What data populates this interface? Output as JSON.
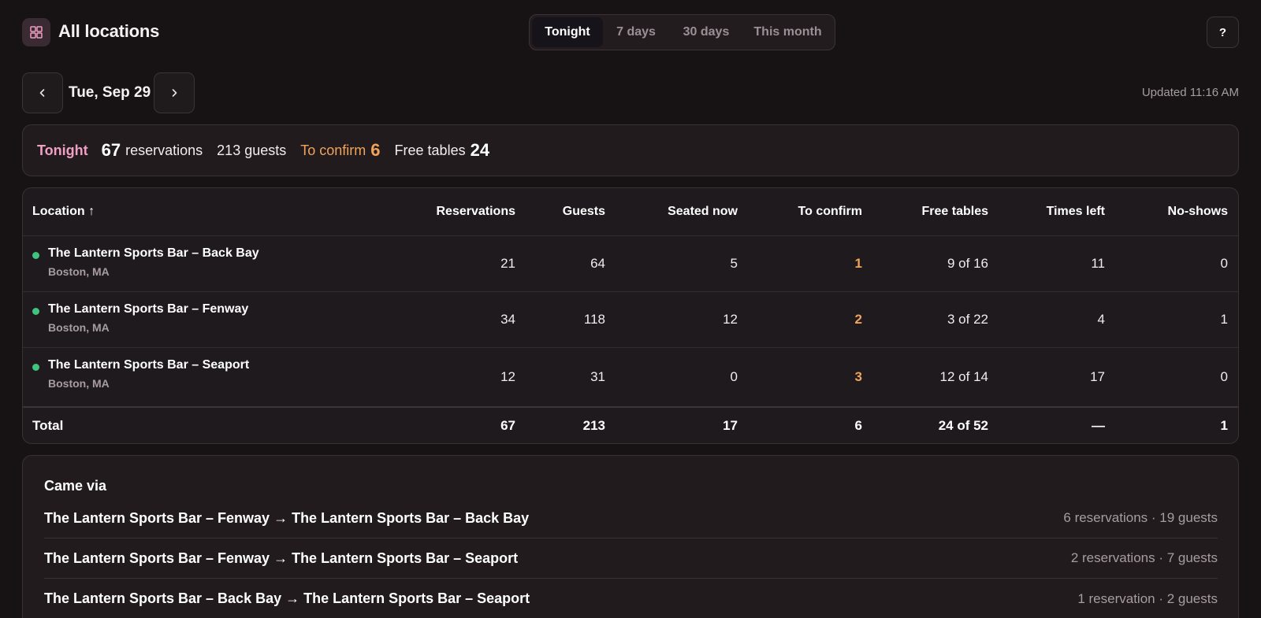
{
  "header": {
    "title": "All locations",
    "icon": "grid-icon",
    "tabs": [
      {
        "label": "Tonight",
        "active": true
      },
      {
        "label": "7 days",
        "active": false
      },
      {
        "label": "30 days",
        "active": false
      },
      {
        "label": "This month",
        "active": false
      }
    ],
    "help_label": "?"
  },
  "date_nav": {
    "date": "Tue, Sep 29",
    "prev_icon": "chevron-left-icon",
    "next_icon": "chevron-right-icon",
    "updated": "Updated 11:16 AM"
  },
  "summary": {
    "label": "Tonight",
    "reservations_value": "67",
    "reservations_label": "reservations",
    "guests": "213 guests",
    "to_confirm_label": "To confirm",
    "to_confirm_value": "6",
    "free_tables_label": "Free tables",
    "free_tables_value": "24"
  },
  "table": {
    "columns": [
      "Location ↑",
      "Reservations",
      "Guests",
      "Seated now",
      "To confirm",
      "Free tables",
      "Times left",
      "No-shows"
    ],
    "rows": [
      {
        "name": "The Lantern Sports Bar – Back Bay",
        "city": "Boston, MA",
        "status": "open",
        "reservations": "21",
        "guests": "64",
        "seated_now": "5",
        "to_confirm": "1",
        "free_tables": "9 of 16",
        "times_left": "11",
        "no_shows": "0"
      },
      {
        "name": "The Lantern Sports Bar – Fenway",
        "city": "Boston, MA",
        "status": "open",
        "reservations": "34",
        "guests": "118",
        "seated_now": "12",
        "to_confirm": "2",
        "free_tables": "3 of 22",
        "times_left": "4",
        "no_shows": "1"
      },
      {
        "name": "The Lantern Sports Bar – Seaport",
        "city": "Boston, MA",
        "status": "open",
        "reservations": "12",
        "guests": "31",
        "seated_now": "0",
        "to_confirm": "3",
        "free_tables": "12 of 14",
        "times_left": "17",
        "no_shows": "0"
      }
    ],
    "total": {
      "label": "Total",
      "reservations": "67",
      "guests": "213",
      "seated_now": "17",
      "to_confirm": "6",
      "free_tables": "24 of 52",
      "times_left": "—",
      "no_shows": "1"
    }
  },
  "came_via": {
    "title": "Came via",
    "items": [
      {
        "route": "The Lantern Sports Bar – Fenway → The Lantern Sports Bar – Back Bay",
        "stat": "6 reservations · 19 guests"
      },
      {
        "route": "The Lantern Sports Bar – Fenway → The Lantern Sports Bar – Seaport",
        "stat": "2 reservations · 7 guests"
      },
      {
        "route": "The Lantern Sports Bar – Back Bay → The Lantern Sports Bar – Seaport",
        "stat": "1 reservation · 2 guests"
      }
    ]
  },
  "colors": {
    "background": "#171314",
    "card": "#1f1a1d",
    "accent_pink": "#f0a0c4",
    "accent_orange": "#f0a35a",
    "status_green": "#3fc47f",
    "muted_text": "#a69ca1"
  }
}
